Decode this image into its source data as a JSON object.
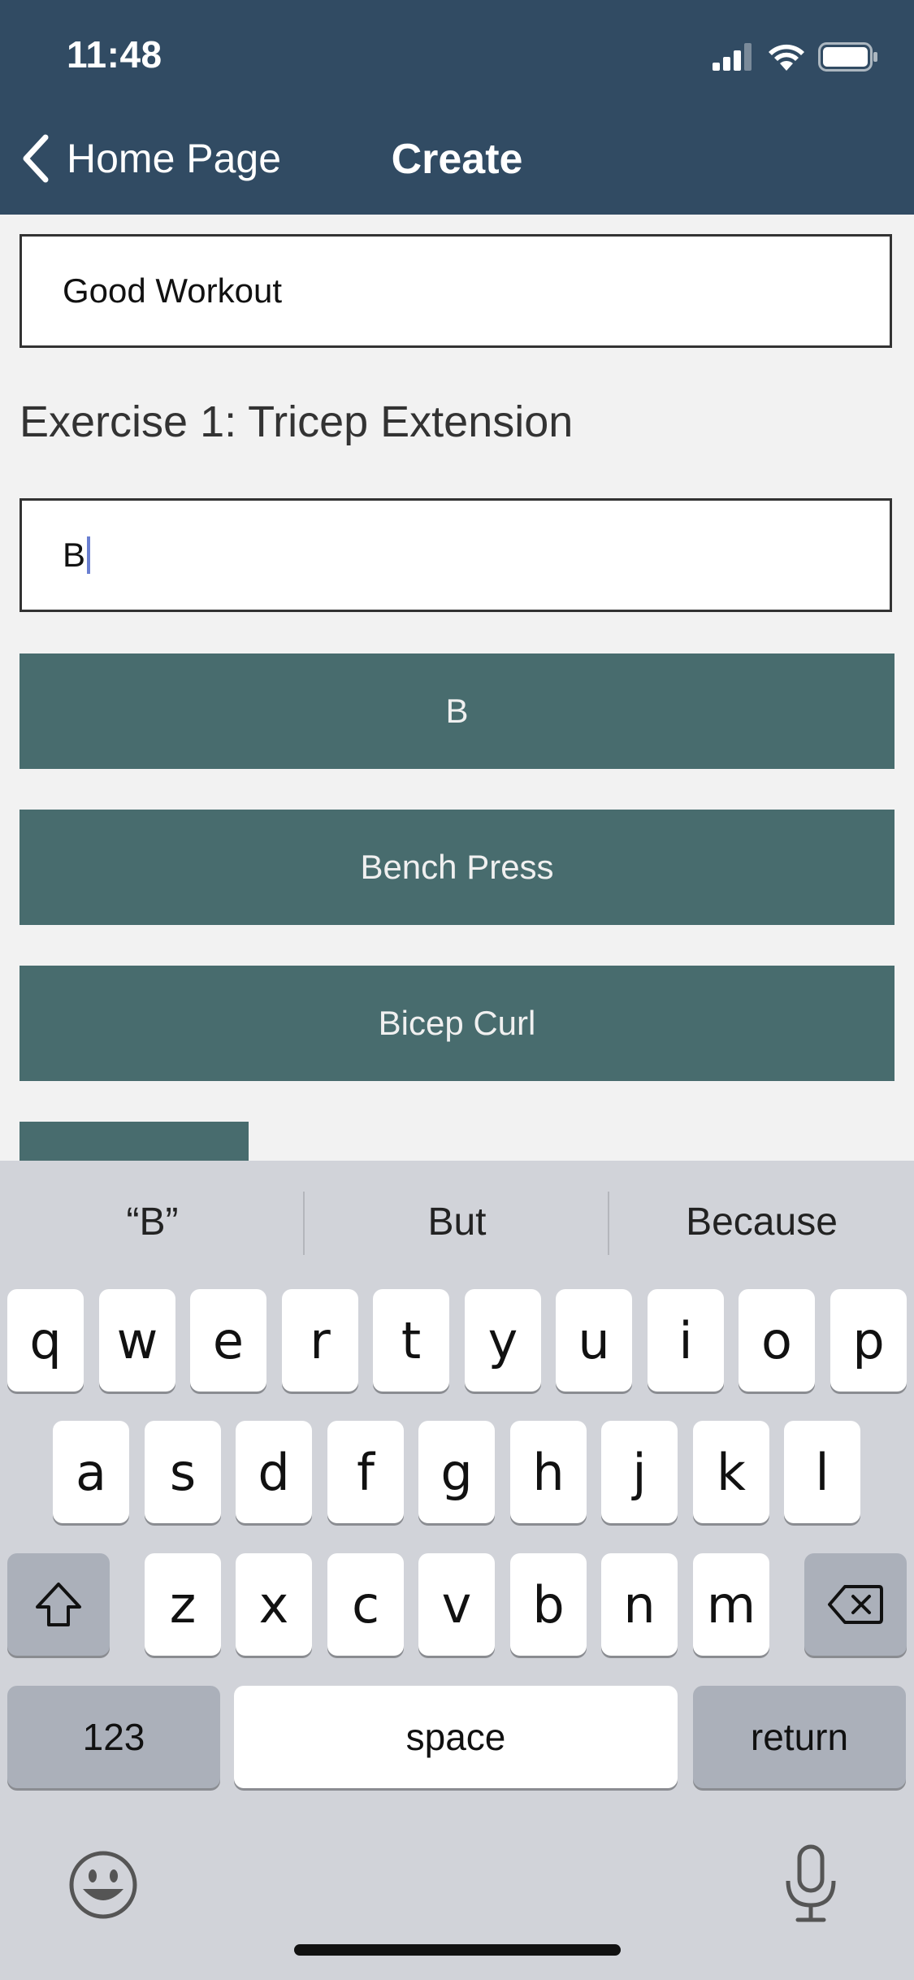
{
  "status_bar": {
    "time": "11:48",
    "icons": [
      "signal-icon",
      "wifi-icon",
      "battery-icon"
    ]
  },
  "nav": {
    "back_label": "Home Page",
    "title": "Create",
    "back_icon": "chevron-left-icon"
  },
  "form": {
    "workout_name_value": "Good Workout",
    "exercise_heading": "Exercise 1: Tricep Extension",
    "search_value": "B"
  },
  "suggestions": [
    "B",
    "Bench Press",
    "Bicep Curl"
  ],
  "keyboard": {
    "predictive": [
      "“B”",
      "But",
      "Because"
    ],
    "row1": [
      "q",
      "w",
      "e",
      "r",
      "t",
      "y",
      "u",
      "i",
      "o",
      "p"
    ],
    "row2": [
      "a",
      "s",
      "d",
      "f",
      "g",
      "h",
      "j",
      "k",
      "l"
    ],
    "row3": [
      "z",
      "x",
      "c",
      "v",
      "b",
      "n",
      "m"
    ],
    "numbers_label": "123",
    "space_label": "space",
    "return_label": "return",
    "shift_icon": "shift-icon",
    "delete_icon": "delete-icon",
    "emoji_icon": "emoji-icon",
    "mic_icon": "microphone-icon"
  },
  "colors": {
    "header": "#314b63",
    "suggestion_button": "#486c6e",
    "background": "#f2f2f2",
    "keyboard": "#d1d3d9"
  }
}
